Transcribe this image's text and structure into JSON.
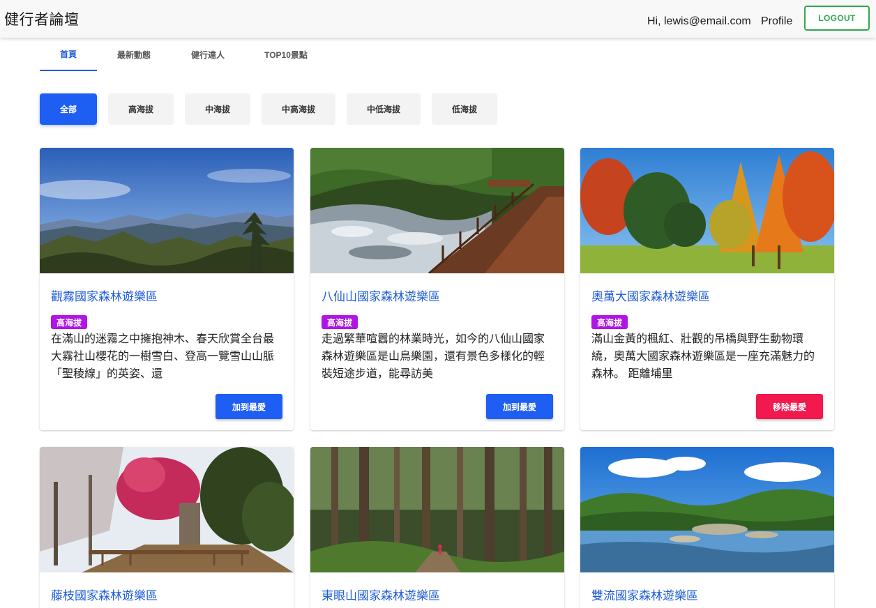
{
  "header": {
    "brand": "健行者論壇",
    "greeting": "Hi, lewis@email.com",
    "profile_label": "Profile",
    "logout_label": "LOGOUT"
  },
  "tabs": [
    {
      "label": "首頁",
      "active": true
    },
    {
      "label": "最新動態",
      "active": false
    },
    {
      "label": "健行達人",
      "active": false
    },
    {
      "label": "TOP10景點",
      "active": false
    }
  ],
  "filters": [
    {
      "label": "全部",
      "active": true
    },
    {
      "label": "高海拔",
      "active": false
    },
    {
      "label": "中海拔",
      "active": false
    },
    {
      "label": "中高海拔",
      "active": false
    },
    {
      "label": "中低海拔",
      "active": false
    },
    {
      "label": "低海拔",
      "active": false
    }
  ],
  "cards": [
    {
      "title": "觀霧國家森林遊樂區",
      "badge": "高海拔",
      "description": "在滿山的迷霧之中擁抱神木、春天欣賞全台最大霧社山櫻花的一樹雪白、登高一覽雪山山脈「聖稜線」的英姿、還",
      "action_label": "加到最愛",
      "action_type": "add"
    },
    {
      "title": "八仙山國家森林遊樂區",
      "badge": "高海拔",
      "description": "走過繁華喧囂的林業時光，如今的八仙山國家森林遊樂區是山鳥樂園，還有景色多樣化的輕裝短途步道，能尋訪美",
      "action_label": "加到最愛",
      "action_type": "add"
    },
    {
      "title": "奧萬大國家森林遊樂區",
      "badge": "高海拔",
      "description": "滿山金黃的楓紅、壯觀的吊橋與野生動物環繞，奧萬大國家森林遊樂區是一座充滿魅力的森林。 距離埔里",
      "action_label": "移除最愛",
      "action_type": "remove"
    },
    {
      "title": "藤枝國家森林遊樂區"
    },
    {
      "title": "東眼山國家森林遊樂區"
    },
    {
      "title": "雙流國家森林遊樂區"
    }
  ],
  "colors": {
    "primary": "#1e5ef3",
    "link": "#1e5bd8",
    "logout": "#2fa84f",
    "badge": "#b014e6",
    "remove": "#f2194f"
  }
}
